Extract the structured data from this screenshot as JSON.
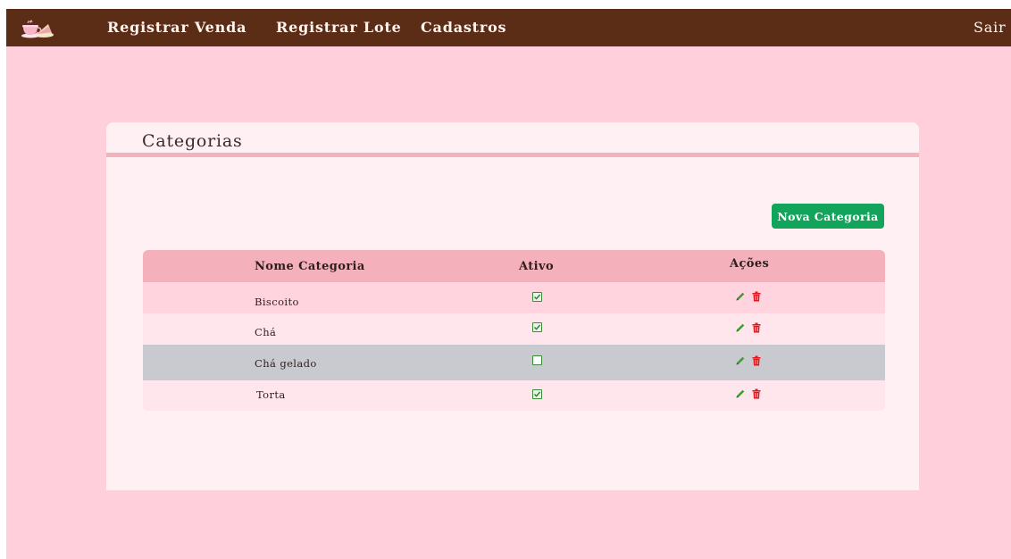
{
  "navbar": {
    "logo_icon": "teapot-cake-logo-icon",
    "links": [
      "Registrar Venda",
      "Registrar Lote",
      "Cadastros"
    ],
    "logout_label": "Sair"
  },
  "page": {
    "title": "Categorias",
    "new_button_label": "Nova Categoria"
  },
  "table": {
    "headers": [
      "Nome Categoria",
      "Ativo",
      "Ações"
    ],
    "rows": [
      {
        "name": "Biscoito",
        "active": true
      },
      {
        "name": "Chá",
        "active": true
      },
      {
        "name": "Chá gelado",
        "active": false
      },
      {
        "name": "Torta",
        "active": true
      }
    ],
    "action_icons": [
      "pencil-icon",
      "trash-icon"
    ]
  },
  "colors": {
    "navbar_bg": "#5c2d16",
    "page_bg": "#ffd0dc",
    "card_bg": "#fff0f3",
    "header_accent": "#f2b3bd",
    "table_header_bg": "#f4b1bc",
    "button_green": "#12a45a",
    "edit_icon": "#3f9c35",
    "delete_icon": "#e8151b",
    "highlight_row": "#c9cacf"
  }
}
